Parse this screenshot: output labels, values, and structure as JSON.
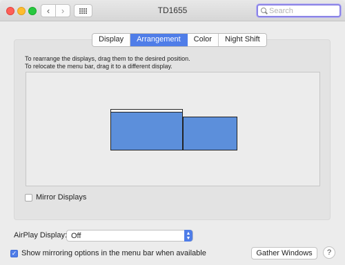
{
  "window": {
    "title": "TD1655"
  },
  "toolbar": {
    "back_icon": "chevron-left-icon",
    "forward_icon": "chevron-right-icon",
    "grid_icon": "grid-icon",
    "back_glyph": "‹",
    "forward_glyph": "›"
  },
  "search": {
    "placeholder": "Search",
    "value": ""
  },
  "tabs": [
    {
      "label": "Display",
      "active": false
    },
    {
      "label": "Arrangement",
      "active": true
    },
    {
      "label": "Color",
      "active": false
    },
    {
      "label": "Night Shift",
      "active": false
    }
  ],
  "arrangement": {
    "instruction_1": "To rearrange the displays, drag them to the desired position.",
    "instruction_2": "To relocate the menu bar, drag it to a different display."
  },
  "mirror": {
    "label": "Mirror Displays",
    "checked": false
  },
  "airplay": {
    "label": "AirPlay Display:",
    "selected": "Off"
  },
  "footer": {
    "show_mirroring_label": "Show mirroring options in the menu bar when available",
    "show_mirroring_checked": true,
    "check_glyph": "✓",
    "gather_label": "Gather Windows",
    "help_label": "?"
  },
  "colors": {
    "accent": "#4f7de8",
    "display_fill": "#5c8fdb",
    "search_focus": "#8b84e6"
  }
}
